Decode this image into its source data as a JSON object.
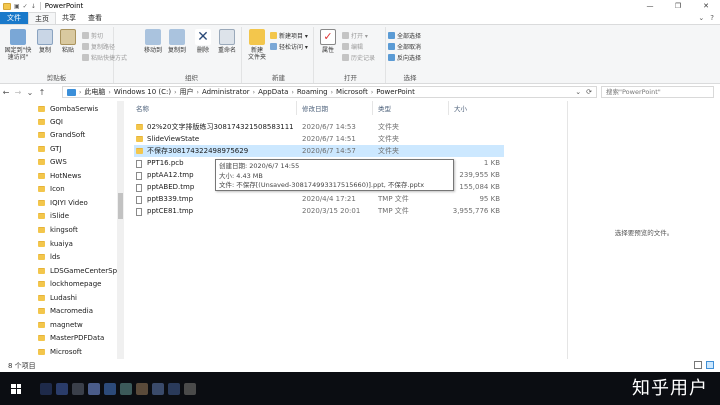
{
  "window": {
    "title": "PowerPoint",
    "quick_access": [
      "▣",
      "✓",
      "↓"
    ],
    "controls": [
      "—",
      "❐",
      "✕"
    ]
  },
  "tabs": [
    {
      "label": "文件",
      "kind": "file"
    },
    {
      "label": "主页",
      "kind": "active"
    },
    {
      "label": "共享",
      "kind": ""
    },
    {
      "label": "查看",
      "kind": ""
    }
  ],
  "ribbon_right": [
    "⌄",
    "?"
  ],
  "ribbon": {
    "clipboard": {
      "label": "剪贴板",
      "pin": "固定到\"快\n速访问\"",
      "copy": "复制",
      "paste": "粘贴",
      "cut": "剪切",
      "copy_path": "复制路径",
      "paste_shortcut": "粘贴快捷方式"
    },
    "organize": {
      "label": "组织",
      "move_to": "移动到",
      "copy_to": "复制到",
      "delete": "删除",
      "rename": "重命名"
    },
    "new": {
      "label": "新建",
      "new_folder": "新建\n文件夹",
      "new_item": "新建项目 ▾",
      "easy_access": "轻松访问 ▾"
    },
    "open": {
      "label": "打开",
      "properties": "属性",
      "open": "打开 ▾",
      "edit": "编辑",
      "history": "历史记录"
    },
    "select": {
      "label": "选择",
      "select_all": "全部选择",
      "select_none": "全部取消",
      "invert": "反向选择"
    }
  },
  "address": {
    "back": "←",
    "forward": "→",
    "recent": "⌄",
    "up": "↑",
    "crumbs": [
      "此电脑",
      "Windows 10 (C:)",
      "用户",
      "Administrator",
      "AppData",
      "Roaming",
      "Microsoft",
      "PowerPoint"
    ],
    "dropdown": "⌄",
    "refresh": "⟳",
    "search_placeholder": "搜索\"PowerPoint\""
  },
  "nav_items": [
    "GombaSerwis",
    "GQI",
    "GrandSoft",
    "GTJ",
    "GWS",
    "HotNews",
    "Icon",
    "IQIYI Video",
    "iSlide",
    "kingsoft",
    "kuaiya",
    "lds",
    "LDSGameCenterSp",
    "lockhomepage",
    "Ludashi",
    "Macromedia",
    "magnetw",
    "MasterPDFData",
    "Microsoft"
  ],
  "columns": {
    "name": "名称",
    "date": "修改日期",
    "type": "类型",
    "size": "大小"
  },
  "files": [
    {
      "name": "02%20文字排版练习308174321508583111",
      "date": "2020/6/7 14:53",
      "type": "文件夹",
      "size": "",
      "kind": "folder"
    },
    {
      "name": "SlideViewState",
      "date": "2020/6/7 14:51",
      "type": "文件夹",
      "size": "",
      "kind": "folder"
    },
    {
      "name": "不保存308174322498975629",
      "date": "2020/6/7 14:57",
      "type": "文件夹",
      "size": "",
      "kind": "folder"
    },
    {
      "name": "PPT16.pcb",
      "date": "",
      "type": "",
      "size": "1 KB",
      "kind": "file"
    },
    {
      "name": "pptAA12.tmp",
      "date": "",
      "type": "",
      "size": "239,955 KB",
      "kind": "file"
    },
    {
      "name": "pptABED.tmp",
      "date": "",
      "type": "",
      "size": "155,084 KB",
      "kind": "file"
    },
    {
      "name": "pptB339.tmp",
      "date": "2020/4/4 17:21",
      "type": "TMP 文件",
      "size": "95 KB",
      "kind": "file"
    },
    {
      "name": "pptCE81.tmp",
      "date": "2020/3/15 20:01",
      "type": "TMP 文件",
      "size": "3,955,776 KB",
      "kind": "file"
    }
  ],
  "tooltip": {
    "line1": "创建日期: 2020/6/7 14:55",
    "line2": "大小: 4.43 MB",
    "line3": "文件: 不保存[(Unsaved-308174993317515660)].ppt, 不保存.pptx"
  },
  "preview_text": "选择要预览的文件。",
  "status": {
    "count": "8 个项目"
  },
  "watermark": "知乎用户",
  "colors": {
    "accent": "#1979ca",
    "selected": "#cce8ff",
    "folder": "#f3c64c",
    "taskbar": "#0b0d12"
  }
}
